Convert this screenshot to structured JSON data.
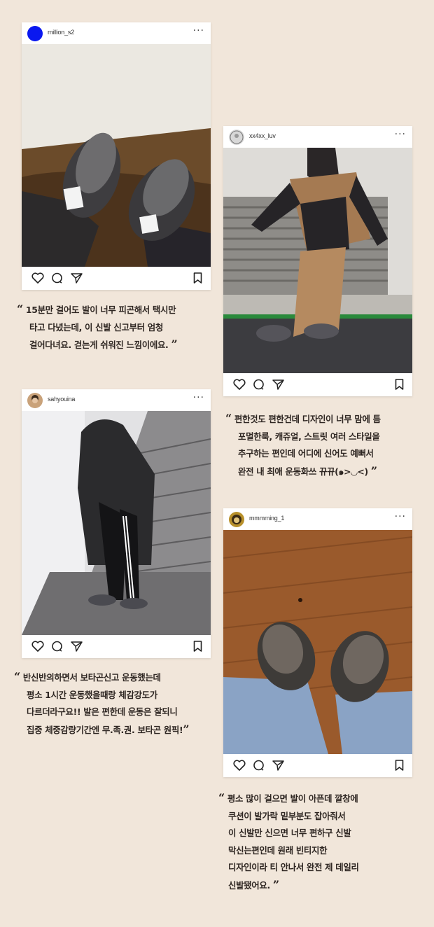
{
  "posts": [
    {
      "username": "million_s2",
      "avatar_color": "#0a18f0",
      "more_icon": "more-horizontal-icon",
      "quote_lines": [
        "15분만 걸어도 발이 너무 피곤해서 택시만",
        "타고 다녔는데, 이 신발 신고부터 엄청",
        "걸어다녀요.  걷는게 쉬워진 느낌이에요."
      ]
    },
    {
      "username": "xx4xx_luv",
      "avatar_color": "#d8d8d8",
      "more_icon": "more-horizontal-icon",
      "quote_lines": [
        "편한것도 편한건데 디자인이 너무 맘에 틈",
        "포멀한룩, 캐쥬얼, 스트릿 여러 스타일을",
        "추구하는 편인데 어디에 신어도 예뻐서",
        "완전 내 최애 운동화쓰 뀨뀨(๑>◡<)"
      ]
    },
    {
      "username": "sahyouina",
      "avatar_color": "#c9a27a",
      "more_icon": "more-horizontal-icon",
      "quote_lines": [
        "반신반의하면서 보타곤신고 운동했는데",
        "평소 1시간 운동했을때랑 체감강도가",
        "다르더라구요!! 발은 편한데 운동은 잘되니",
        "집중 체중감량기간엔 무.족.권. 보타곤 원픽!"
      ]
    },
    {
      "username": "mmmming_1",
      "avatar_color": "#b8902a",
      "more_icon": "more-horizontal-icon",
      "quote_lines": [
        "평소 많이 걸으면 발이 아픈데 깔창에",
        "쿠션이 발가락 밑부분도 잡아줘서",
        "이 신발만 신으면 너무 편하구 신발",
        "막신는편인데 원래 빈티지한",
        "디자인이라 티 안나서 완전 제 데일리",
        "신발됐어요."
      ]
    }
  ],
  "quote_open": "“",
  "quote_close": "”",
  "action_icons": [
    "heart-icon",
    "comment-icon",
    "share-icon",
    "bookmark-icon"
  ]
}
